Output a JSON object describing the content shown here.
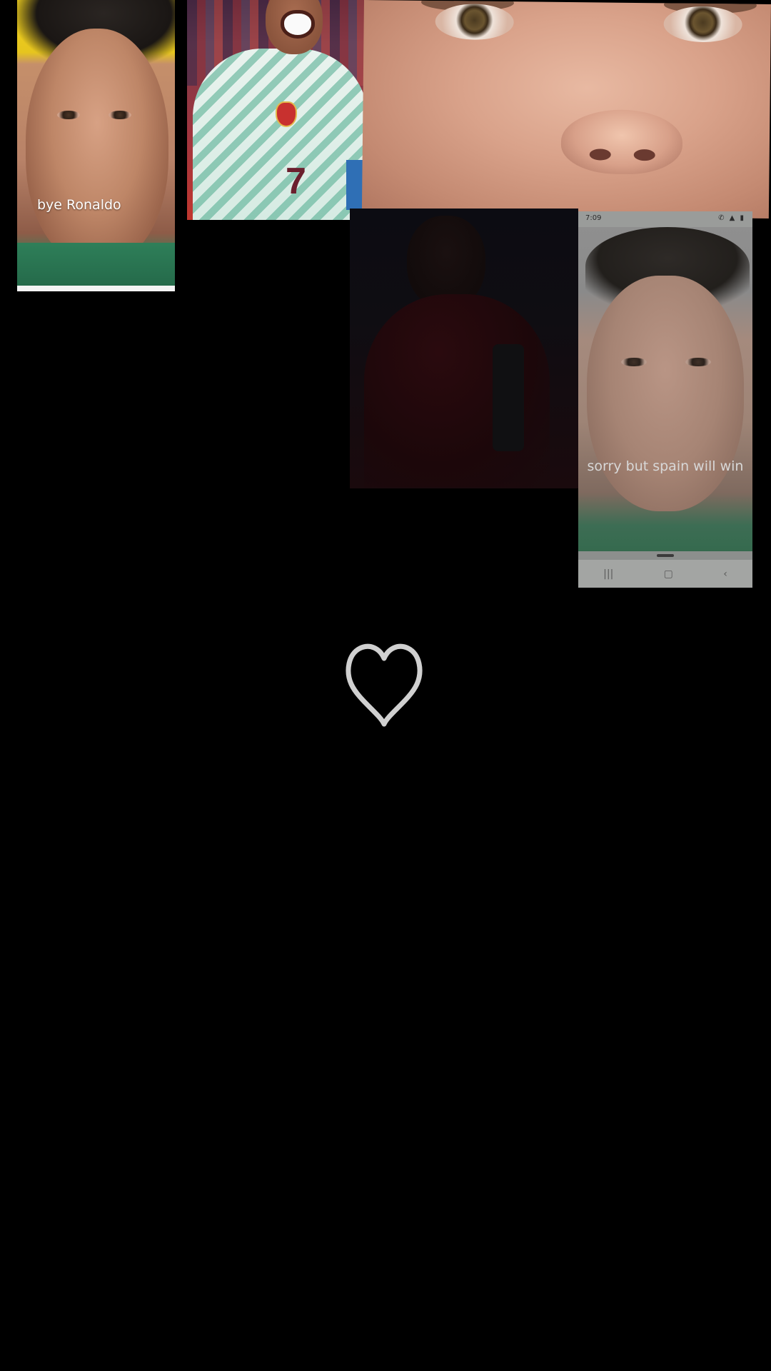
{
  "tiles": {
    "portrait_caption": {
      "caption": "bye Ronaldo"
    },
    "celebration": {
      "jersey_number": "7"
    },
    "phone_screenshot": {
      "status_time": "7:09",
      "status_icons": "✆ ▲ ▮",
      "caption": "sorry but spain will win",
      "nav": {
        "recents": "|||",
        "home": "▢",
        "back": "‹"
      }
    }
  },
  "colors": {
    "background": "#000000",
    "heart_stroke": "#d0d0d0",
    "caption_text": "#ffffff"
  },
  "icons": {
    "heart": "heart-outline-icon"
  }
}
